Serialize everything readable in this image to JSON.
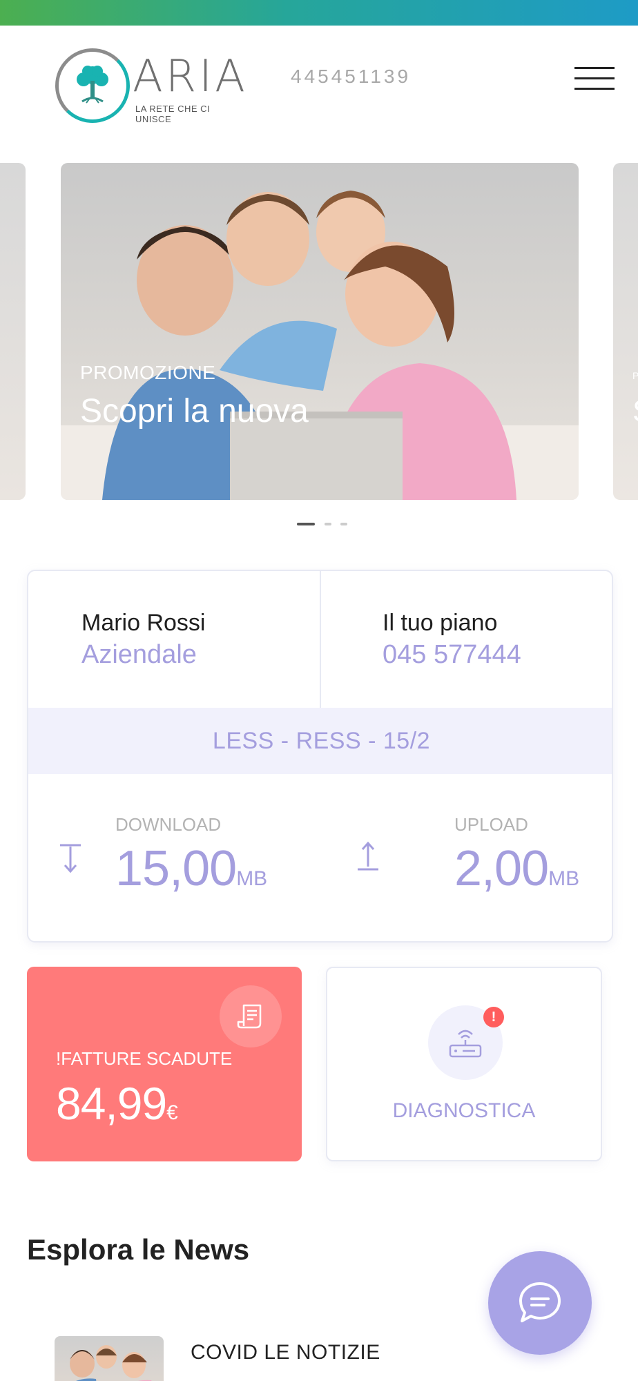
{
  "header": {
    "brand_name": "ARIA",
    "brand_tagline": "LA RETE CHE CI UNISCE",
    "phone": "445451139",
    "menu_icon": "hamburger-menu-icon"
  },
  "carousel": {
    "active_slide": {
      "kicker": "PROMOZIONE",
      "title": "Scopri la nuova"
    },
    "next_slide_title_fragment": "S",
    "next_slide_kicker_fragment": "P",
    "slide_count": 3,
    "active_index": 0
  },
  "account": {
    "name": "Mario Rossi",
    "type": "Aziendale",
    "plan_label": "Il tuo piano",
    "plan_number": "045 577444",
    "plan_name": "LESS - RESS - 15/2",
    "download": {
      "label": "DOWNLOAD",
      "value": "15,00",
      "unit": "MB",
      "icon": "download-arrow-icon"
    },
    "upload": {
      "label": "UPLOAD",
      "value": "2,00",
      "unit": "MB",
      "icon": "upload-arrow-icon"
    }
  },
  "bills_tile": {
    "label": "!FATTURE SCADUTE",
    "amount": "84,99",
    "currency": "€",
    "icon": "receipt-icon",
    "color": "#ff7a7a"
  },
  "diagnostics_tile": {
    "label": "DIAGNOSTICA",
    "alert": "!",
    "icon": "router-icon"
  },
  "news": {
    "section_title": "Esplora le News",
    "items": [
      {
        "title": "COVID LE NOTIZIE"
      }
    ]
  },
  "chat": {
    "icon": "chat-bubble-icon"
  },
  "colors": {
    "accent": "#a49ede",
    "alert": "#ff5d5d",
    "bar_gradient_start": "#4caf50",
    "bar_gradient_end": "#1e9bc6"
  }
}
